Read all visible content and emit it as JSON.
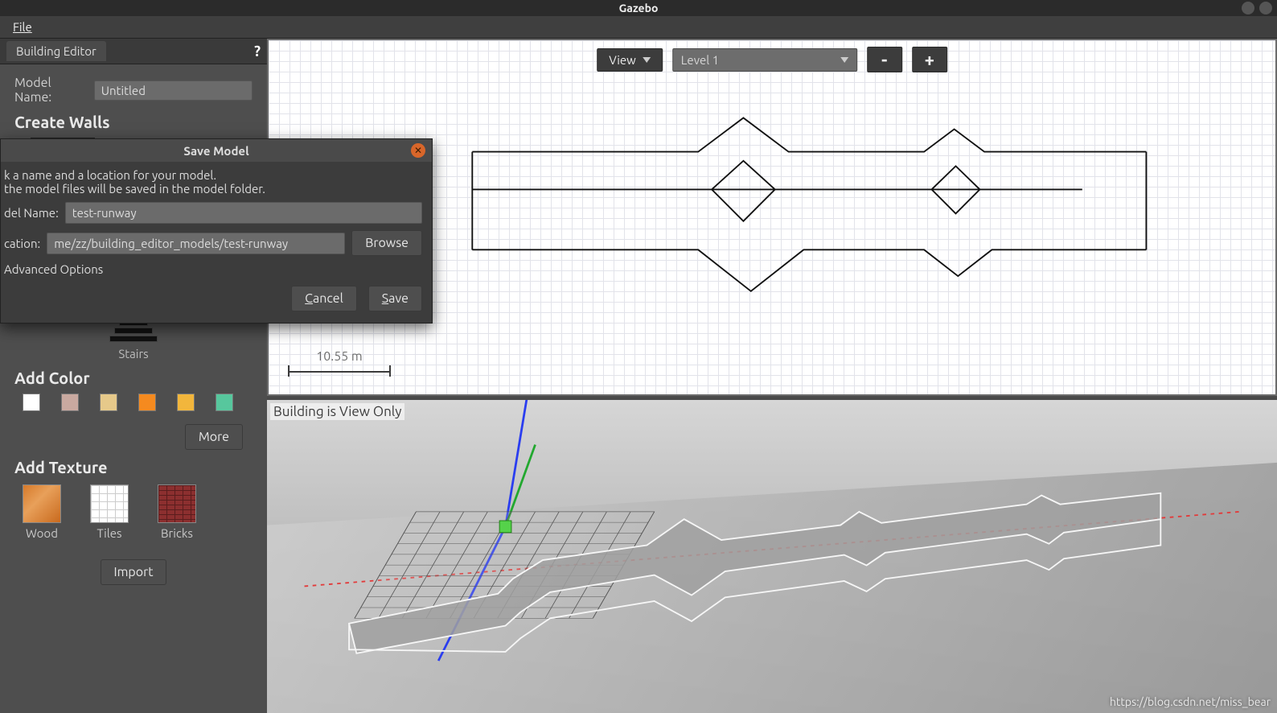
{
  "window": {
    "title": "Gazebo"
  },
  "menubar": {
    "file": "File"
  },
  "sidebar": {
    "tab": "Building Editor",
    "help": "?",
    "model_name_label": "Model Name:",
    "model_name_value": "Untitled",
    "section_create_walls": "Create Walls",
    "stairs_caption": "Stairs",
    "section_add_color": "Add Color",
    "colors": [
      "#ffffff",
      "#c9a9a0",
      "#e6c98a",
      "#f58a1f",
      "#f2b63c",
      "#57c79d"
    ],
    "more_button": "More",
    "section_add_texture": "Add Texture",
    "textures": [
      {
        "id": "wood",
        "label": "Wood"
      },
      {
        "id": "tiles",
        "label": "Tiles"
      },
      {
        "id": "bricks",
        "label": "Bricks"
      }
    ],
    "import_button": "Import"
  },
  "plan_toolbar": {
    "view_button": "View",
    "level_select": "Level 1",
    "minus": "-",
    "plus": "+"
  },
  "scale": {
    "label": "10.55 m"
  },
  "view3d": {
    "overlay": "Building is View Only"
  },
  "save_dialog": {
    "title": "Save Model",
    "info_line1": "k a name and a location for your model.",
    "info_line2": "the model files will be saved in the model folder.",
    "model_name_label": "del Name:",
    "model_name_value": "test-runway",
    "location_label": "cation:",
    "location_value": "me/zz/building_editor_models/test-runway",
    "browse": "Browse",
    "advanced": "Advanced Options",
    "cancel": "Cancel",
    "save": "Save"
  },
  "watermark": "https://blog.csdn.net/miss_bear"
}
